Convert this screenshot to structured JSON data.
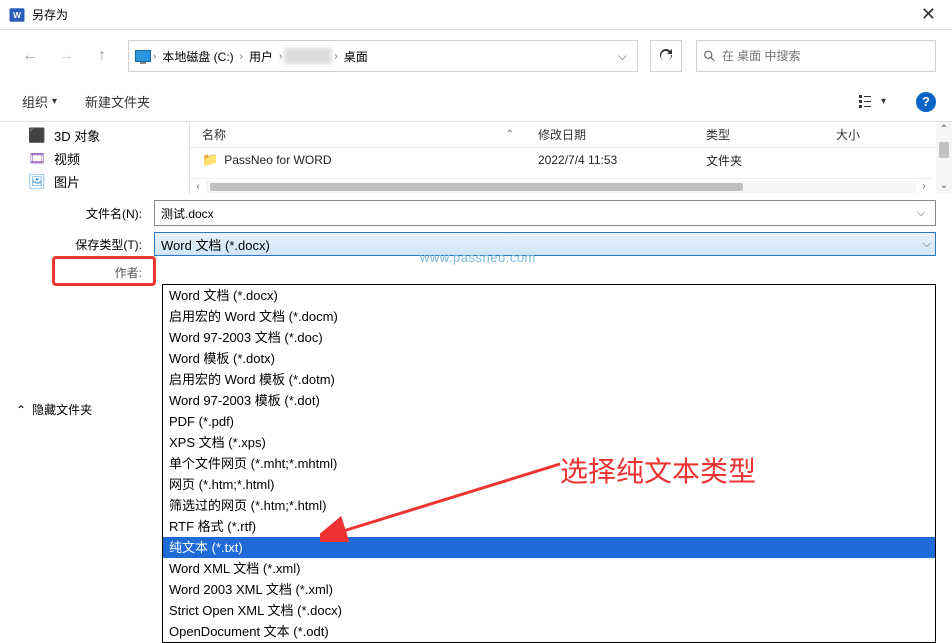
{
  "title": "另存为",
  "breadcrumb": {
    "drive": "本地磁盘 (C:)",
    "users": "用户",
    "desktop": "桌面"
  },
  "search": {
    "placeholder": "在 桌面 中搜索"
  },
  "toolbar": {
    "organize": "组织",
    "newfolder": "新建文件夹"
  },
  "sidebar": {
    "objects3d": "3D 对象",
    "videos": "视频",
    "pictures": "图片"
  },
  "columns": {
    "name": "名称",
    "date": "修改日期",
    "type": "类型",
    "size": "大小"
  },
  "files": [
    {
      "name": "PassNeo for WORD",
      "date": "2022/7/4 11:53",
      "type": "文件夹"
    }
  ],
  "filename": {
    "label": "文件名(N):",
    "value": "测试.docx"
  },
  "savetype": {
    "label": "保存类型(T):",
    "value": "Word 文档 (*.docx)"
  },
  "author": {
    "label": "作者:"
  },
  "save_type_options": [
    "Word 文档 (*.docx)",
    "启用宏的 Word 文档 (*.docm)",
    "Word 97-2003 文档 (*.doc)",
    "Word 模板 (*.dotx)",
    "启用宏的 Word 模板 (*.dotm)",
    "Word 97-2003 模板 (*.dot)",
    "PDF (*.pdf)",
    "XPS 文档 (*.xps)",
    "单个文件网页 (*.mht;*.mhtml)",
    "网页 (*.htm;*.html)",
    "筛选过的网页 (*.htm;*.html)",
    "RTF 格式 (*.rtf)",
    "纯文本 (*.txt)",
    "Word XML 文档 (*.xml)",
    "Word 2003 XML 文档 (*.xml)",
    "Strict Open XML 文档 (*.docx)",
    "OpenDocument 文本 (*.odt)"
  ],
  "selected_option_index": 12,
  "footer": {
    "hide_folders": "隐藏文件夹"
  },
  "annotation": "选择纯文本类型",
  "watermark": "www.passneo.com"
}
